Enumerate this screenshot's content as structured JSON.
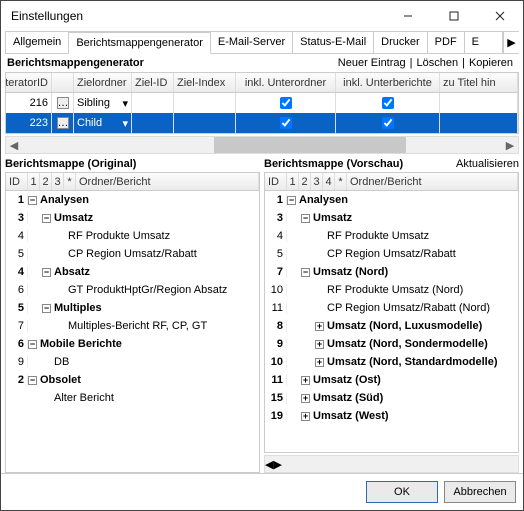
{
  "window": {
    "title": "Einstellungen"
  },
  "tabs": {
    "items": [
      "Allgemein",
      "Berichtsmappengenerator",
      "E-Mail-Server",
      "Status-E-Mail",
      "Drucker",
      "PDF",
      "E"
    ],
    "active": 1
  },
  "section": {
    "title": "Berichtsmappengenerator"
  },
  "actions": {
    "new": "Neuer Eintrag",
    "delete": "Löschen",
    "copy": "Kopieren"
  },
  "grid": {
    "headers": {
      "iterator": "IteratorID",
      "ziel": "Zielordner",
      "zielid": "Ziel-ID",
      "zielindex": "Ziel-Index",
      "sub": "inkl. Unterordner",
      "subrep": "inkl. Unterberichte",
      "titel": "zu Titel hin"
    },
    "rows": [
      {
        "id": "216",
        "ziel": "Sibling",
        "sub": true,
        "subrep": true
      },
      {
        "id": "223",
        "ziel": "Child",
        "sub": true,
        "subrep": true,
        "selected": true
      }
    ]
  },
  "original": {
    "title": "Berichtsmappe (Original)",
    "cols": {
      "id": "ID",
      "n1": "1",
      "n2": "2",
      "n3": "3",
      "star": "*",
      "rest": "Ordner/Bericht"
    },
    "rows": [
      {
        "id": "1",
        "text": "Analysen",
        "bold": true,
        "exp": "-",
        "depth": 0
      },
      {
        "id": "3",
        "text": "Umsatz",
        "bold": true,
        "exp": "-",
        "depth": 1
      },
      {
        "id": "4",
        "text": "RF Produkte Umsatz",
        "depth": 2
      },
      {
        "id": "5",
        "text": "CP Region Umsatz/Rabatt",
        "depth": 2
      },
      {
        "id": "4",
        "text": "Absatz",
        "bold": true,
        "exp": "-",
        "depth": 1
      },
      {
        "id": "6",
        "text": "GT ProduktHptGr/Region Absatz",
        "depth": 2
      },
      {
        "id": "5",
        "text": "Multiples",
        "bold": true,
        "exp": "-",
        "depth": 1
      },
      {
        "id": "7",
        "text": "Multiples-Bericht RF, CP, GT",
        "depth": 2
      },
      {
        "id": "6",
        "text": "Mobile Berichte",
        "bold": true,
        "exp": "-",
        "depth": 0
      },
      {
        "id": "9",
        "text": "DB",
        "depth": 1
      },
      {
        "id": "2",
        "text": "Obsolet",
        "bold": true,
        "exp": "-",
        "depth": 0
      },
      {
        "id": "",
        "text": "Alter Bericht",
        "depth": 1
      }
    ]
  },
  "preview": {
    "title": "Berichtsmappe (Vorschau)",
    "action": "Aktualisieren",
    "cols": {
      "id": "ID",
      "n1": "1",
      "n2": "2",
      "n3": "3",
      "n4": "4",
      "star": "*",
      "rest": "Ordner/Bericht"
    },
    "rows": [
      {
        "id": "1",
        "text": "Analysen",
        "bold": true,
        "exp": "-",
        "depth": 0
      },
      {
        "id": "3",
        "text": "Umsatz",
        "bold": true,
        "exp": "-",
        "depth": 1
      },
      {
        "id": "4",
        "text": "RF Produkte Umsatz",
        "depth": 2
      },
      {
        "id": "5",
        "text": "CP Region Umsatz/Rabatt",
        "depth": 2
      },
      {
        "id": "7",
        "text": "Umsatz (Nord)",
        "bold": true,
        "exp": "-",
        "depth": 1
      },
      {
        "id": "10",
        "text": "RF Produkte Umsatz (Nord)",
        "depth": 2
      },
      {
        "id": "11",
        "text": "CP Region Umsatz/Rabatt (Nord)",
        "depth": 2
      },
      {
        "id": "8",
        "text": "Umsatz (Nord, Luxusmodelle)",
        "bold": true,
        "exp": "+",
        "depth": 2
      },
      {
        "id": "9",
        "text": "Umsatz (Nord, Sondermodelle)",
        "bold": true,
        "exp": "+",
        "depth": 2
      },
      {
        "id": "10",
        "text": "Umsatz (Nord, Standardmodelle)",
        "bold": true,
        "exp": "+",
        "depth": 2
      },
      {
        "id": "11",
        "text": "Umsatz (Ost)",
        "bold": true,
        "exp": "+",
        "depth": 1
      },
      {
        "id": "15",
        "text": "Umsatz (Süd)",
        "bold": true,
        "exp": "+",
        "depth": 1
      },
      {
        "id": "19",
        "text": "Umsatz (West)",
        "bold": true,
        "exp": "+",
        "depth": 1
      }
    ]
  },
  "footer": {
    "ok": "OK",
    "cancel": "Abbrechen"
  }
}
